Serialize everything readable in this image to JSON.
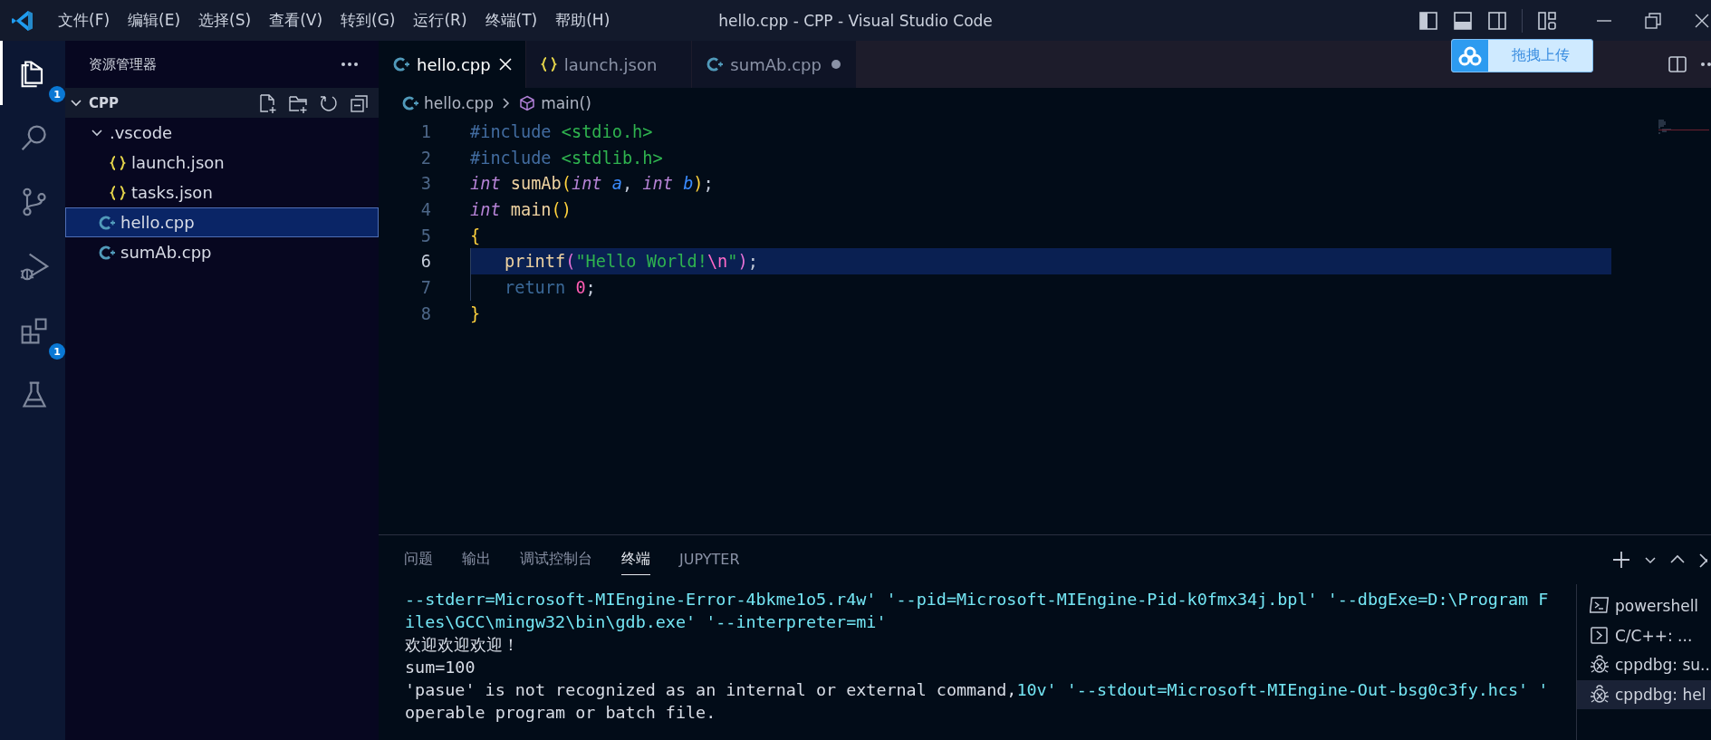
{
  "title_bar": {
    "menus": [
      "文件(F)",
      "编辑(E)",
      "选择(S)",
      "查看(V)",
      "转到(G)",
      "运行(R)",
      "终端(T)",
      "帮助(H)"
    ],
    "title": "hello.cpp - CPP - Visual Studio Code"
  },
  "activity_bar": [
    {
      "kind": "explorer",
      "selected": true,
      "badge": "1"
    },
    {
      "kind": "search",
      "selected": false
    },
    {
      "kind": "source-control",
      "selected": false
    },
    {
      "kind": "run-debug",
      "selected": false
    },
    {
      "kind": "extensions",
      "selected": false,
      "badge": "1"
    },
    {
      "kind": "testing",
      "selected": false
    }
  ],
  "sidebar": {
    "title": "资源管理器",
    "section": {
      "title": "CPP",
      "expanded": true
    },
    "tree": [
      {
        "label": ".vscode",
        "kind": "folder",
        "expanded": true,
        "selected": false,
        "children": [
          {
            "label": "launch.json",
            "kind": "json",
            "selected": false
          },
          {
            "label": "tasks.json",
            "kind": "json",
            "selected": false
          }
        ]
      },
      {
        "label": "hello.cpp",
        "kind": "cpp",
        "selected": true
      },
      {
        "label": "sumAb.cpp",
        "kind": "cpp",
        "selected": false
      }
    ]
  },
  "tabs": [
    {
      "label": "hello.cpp",
      "kind": "cpp",
      "selected": true,
      "modified": false
    },
    {
      "label": "launch.json",
      "kind": "json",
      "selected": false,
      "modified": false
    },
    {
      "label": "sumAb.cpp",
      "kind": "cpp",
      "selected": false,
      "modified": true
    }
  ],
  "upload_widget": {
    "label": "拖拽上传"
  },
  "breadcrumb": [
    {
      "label": "hello.cpp",
      "kind": "cpp"
    },
    {
      "label": "main()",
      "kind": "function"
    }
  ],
  "editor": {
    "lines": [
      {
        "number": "1",
        "current": false,
        "indented": false,
        "tokens": [
          {
            "text": "#include ",
            "kind": "directive"
          },
          {
            "text": "<stdio.h>",
            "kind": "string"
          }
        ]
      },
      {
        "number": "2",
        "current": false,
        "indented": false,
        "tokens": [
          {
            "text": "#include ",
            "kind": "directive"
          },
          {
            "text": "<stdlib.h>",
            "kind": "string"
          }
        ]
      },
      {
        "number": "3",
        "current": false,
        "indented": false,
        "tokens": [
          {
            "text": "int ",
            "kind": "type"
          },
          {
            "text": "sumAb",
            "kind": "function"
          },
          {
            "text": "(",
            "kind": "bracket1"
          },
          {
            "text": "int ",
            "kind": "type"
          },
          {
            "text": "a",
            "kind": "param"
          },
          {
            "text": ", ",
            "kind": "plain"
          },
          {
            "text": "int ",
            "kind": "type"
          },
          {
            "text": "b",
            "kind": "param"
          },
          {
            "text": ")",
            "kind": "bracket1"
          },
          {
            "text": ";",
            "kind": "plain"
          }
        ]
      },
      {
        "number": "4",
        "current": false,
        "indented": false,
        "tokens": [
          {
            "text": "int ",
            "kind": "type"
          },
          {
            "text": "main",
            "kind": "function"
          },
          {
            "text": "()",
            "kind": "bracket1"
          }
        ]
      },
      {
        "number": "5",
        "current": false,
        "indented": false,
        "tokens": [
          {
            "text": "{",
            "kind": "bracket1"
          }
        ]
      },
      {
        "number": "6",
        "current": true,
        "indented": true,
        "tokens": [
          {
            "text": "printf",
            "kind": "function"
          },
          {
            "text": "(",
            "kind": "bracket2"
          },
          {
            "text": "\"Hello World!",
            "kind": "string"
          },
          {
            "text": "\\n",
            "kind": "escape"
          },
          {
            "text": "\"",
            "kind": "string"
          },
          {
            "text": ")",
            "kind": "bracket2"
          },
          {
            "text": ";",
            "kind": "plain"
          }
        ]
      },
      {
        "number": "7",
        "current": false,
        "indented": true,
        "tokens": [
          {
            "text": "return ",
            "kind": "keyword"
          },
          {
            "text": "0",
            "kind": "number"
          },
          {
            "text": ";",
            "kind": "plain"
          }
        ]
      },
      {
        "number": "8",
        "current": false,
        "indented": false,
        "tokens": [
          {
            "text": "}",
            "kind": "bracket1"
          }
        ]
      }
    ]
  },
  "panel": {
    "tabs": [
      {
        "label": "问题",
        "selected": false
      },
      {
        "label": "输出",
        "selected": false
      },
      {
        "label": "调试控制台",
        "selected": false
      },
      {
        "label": "终端",
        "selected": true
      },
      {
        "label": "JUPYTER",
        "selected": false
      }
    ],
    "terminal_lines": [
      [
        {
          "text": "--stderr=Microsoft-MIEngine-Error-4bkme1o5.r4w' '--pid=Microsoft-MIEngine-Pid-k0fmx34j.bpl' '--dbgExe=D:\\Program F",
          "kind": "cyan"
        }
      ],
      [
        {
          "text": "iles\\GCC\\mingw32\\bin\\gdb.exe' '--interpreter=mi'",
          "kind": "cyan"
        }
      ],
      [
        {
          "text": "欢迎欢迎欢迎！",
          "kind": "white"
        }
      ],
      [
        {
          "text": "sum=100",
          "kind": "white"
        }
      ],
      [
        {
          "text": "'pasue' is not recognized as an internal or external command,",
          "kind": "white"
        },
        {
          "text": "10v' '--stdout=Microsoft-MIEngine-Out-bsg0c3fy.hcs' '",
          "kind": "cyan"
        }
      ],
      [
        {
          "text": "operable program or batch file.",
          "kind": "white"
        }
      ]
    ],
    "terminals": [
      {
        "label": "powershell",
        "kind": "shell",
        "selected": false
      },
      {
        "label": "C/C++: ...",
        "kind": "task",
        "selected": false
      },
      {
        "label": "cppdbg: su...",
        "kind": "debug",
        "selected": false
      },
      {
        "label": "cppdbg: hel",
        "kind": "debug",
        "selected": true
      }
    ]
  }
}
